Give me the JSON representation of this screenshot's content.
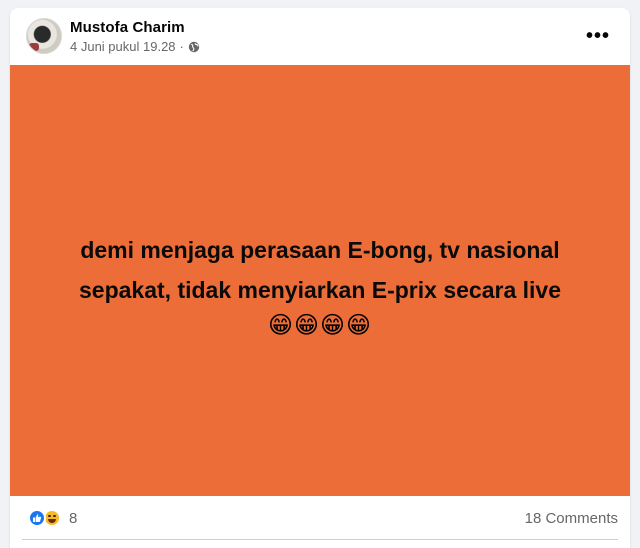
{
  "post": {
    "author": "Mustofa Charim",
    "timestamp": "4 Juni pukul 19.28",
    "separator": "·",
    "privacy_icon": "globe-icon",
    "more_label": "•••",
    "background_color": "#ec6d38",
    "text_line1": "demi menjaga perasaan E-bong, tv nasional",
    "text_line2": "sepakat, tidak menyiarkan E-prix secara live",
    "emojis": "😁😁😁😁"
  },
  "footer": {
    "reaction_icons": [
      "like-icon",
      "haha-icon"
    ],
    "reaction_count": "8",
    "comments_count": "18 Comments"
  }
}
